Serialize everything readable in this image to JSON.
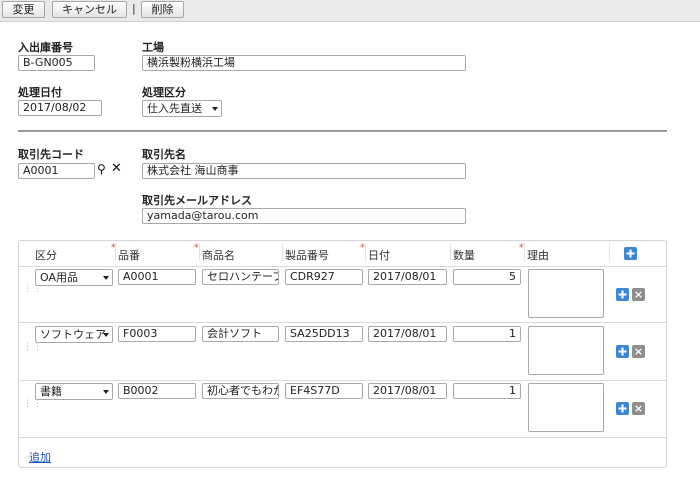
{
  "toolbar": {
    "change_label": "変更",
    "cancel_label": "キャンセル",
    "separator": "|",
    "delete_label": "削除"
  },
  "form": {
    "receipt_no_label": "入出庫番号",
    "receipt_no_value": "B-GN005",
    "factory_label": "工場",
    "factory_value": "横浜製粉横浜工場",
    "process_date_label": "処理日付",
    "process_date_value": "2017/08/02",
    "process_type_label": "処理区分",
    "process_type_value": "仕入先直送",
    "client_code_label": "取引先コード",
    "client_code_value": "A0001",
    "client_name_label": "取引先名",
    "client_name_value": "株式会社 海山商事",
    "client_email_label": "取引先メールアドレス",
    "client_email_value": "yamada@tarou.com"
  },
  "grid": {
    "headers": {
      "category": "区分",
      "item_no": "品番",
      "product_name": "商品名",
      "serial_no": "製品番号",
      "date": "日付",
      "quantity": "数量",
      "reason": "理由"
    },
    "rows": [
      {
        "category": "OA用品",
        "item_no": "A0001",
        "product_name": "セロハンテープ",
        "serial_no": "CDR927",
        "date": "2017/08/01",
        "quantity": "5"
      },
      {
        "category": "ソフトウェア",
        "item_no": "F0003",
        "product_name": "会計ソフト",
        "serial_no": "SA25DD13",
        "date": "2017/08/01",
        "quantity": "1"
      },
      {
        "category": "書籍",
        "item_no": "B0002",
        "product_name": "初心者でもわか",
        "serial_no": "EF4S77D",
        "date": "2017/08/01",
        "quantity": "1"
      }
    ],
    "add_link": "追加"
  },
  "colors": {
    "accent_blue": "#3b87d6",
    "required_mark": "#e04020",
    "link": "#1a4fbf"
  }
}
